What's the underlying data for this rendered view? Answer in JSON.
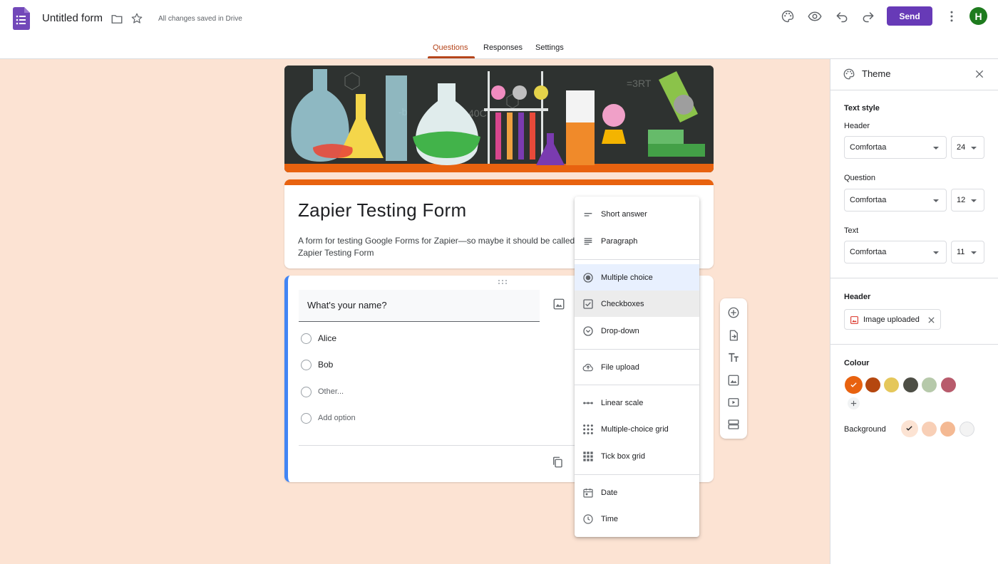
{
  "header": {
    "doc_title": "Untitled form",
    "saved_status": "All changes saved in Drive",
    "send_label": "Send",
    "avatar_initial": "H",
    "tabs": [
      "Questions",
      "Responses",
      "Settings"
    ]
  },
  "form": {
    "title": "Zapier Testing Form",
    "description": "A form for testing Google Forms for Zapier—so maybe it should be called Zapier Testing Form"
  },
  "question": {
    "title": "What's your name?",
    "options": [
      "Alice",
      "Bob"
    ],
    "other_label": "Other...",
    "add_option_label": "Add option"
  },
  "menu": {
    "items": [
      "Short answer",
      "Paragraph",
      "Multiple choice",
      "Checkboxes",
      "Drop-down",
      "File upload",
      "Linear scale",
      "Multiple-choice grid",
      "Tick box grid",
      "Date",
      "Time"
    ],
    "selected": "Multiple choice"
  },
  "theme": {
    "title": "Theme",
    "text_style_label": "Text style",
    "header_label": "Header",
    "header_font": "Comfortaa",
    "header_size": "24",
    "question_label": "Question",
    "question_font": "Comfortaa",
    "question_size": "12",
    "text_label": "Text",
    "text_font": "Comfortaa",
    "text_size": "11",
    "header_section_label": "Header",
    "image_chip_label": "Image uploaded",
    "colour_label": "Colour",
    "colours": [
      "#e8620f",
      "#b5470f",
      "#e5c75a",
      "#4d4e45",
      "#b6c9aa",
      "#b85b6c"
    ],
    "selected_colour": "#e8620f",
    "background_label": "Background",
    "backgrounds": [
      "#fce3d3",
      "#f8cfb6",
      "#f4b993",
      "#f3f3f3"
    ],
    "selected_background": "#fce3d3"
  },
  "colors": {
    "accent": "#673ab7",
    "theme": "#e8620f",
    "question_border": "#4285f4"
  }
}
